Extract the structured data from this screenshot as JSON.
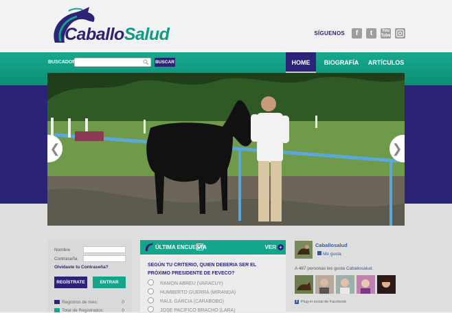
{
  "header": {
    "logo_part1": "Caballo",
    "logo_part2": "Salud",
    "social_label": "SÍGUENOS",
    "social_icons": [
      "facebook-icon",
      "twitter-icon",
      "youtube-icon",
      "instagram-icon"
    ],
    "youtube_text": "You Tube"
  },
  "search": {
    "label": "BUSCADOR",
    "placeholder": "",
    "button": "BUSCAR"
  },
  "nav": {
    "items": [
      {
        "label": "HOME",
        "active": true
      },
      {
        "label": "BIOGRAFÍA",
        "active": false
      },
      {
        "label": "ARTÍCULOS",
        "active": false
      }
    ]
  },
  "login": {
    "name_label": "Nombre",
    "password_label": "Contraseña",
    "forgot": "Olvidaste tu Contraseña?",
    "register_button": "REGÍSTRATE",
    "enter_button": "ENTRAR",
    "stats": [
      {
        "label": "Registros de mes:",
        "value": "0"
      },
      {
        "label": "Total de Registrados:",
        "value": "0"
      }
    ]
  },
  "poll": {
    "title": "ÚLTIMA ENCUESTA",
    "view": "VER",
    "question": "SEGÚN TU CRITERIO, QUIEN DEBERIA SER EL PRÓXIMO PRESIDENTE DE FEVECO?",
    "options": [
      "RAMON ABREU (VARACUY)",
      "HUMBERTO GUERRA (MIRANDA)",
      "RAUL GARCIA (CARABOBO)",
      "JOSE PACIFICO BRACHO (LARA)"
    ]
  },
  "facebook": {
    "page_name": "Caballosalud",
    "like": "Me gusta",
    "count_text": "A 487 personas les gusta",
    "count_link": "Caballosalud.",
    "plugin": "Plug-in social de Facebook"
  },
  "colors": {
    "purple": "#2a2377",
    "teal": "#13a48a",
    "facebook": "#3b5998"
  }
}
